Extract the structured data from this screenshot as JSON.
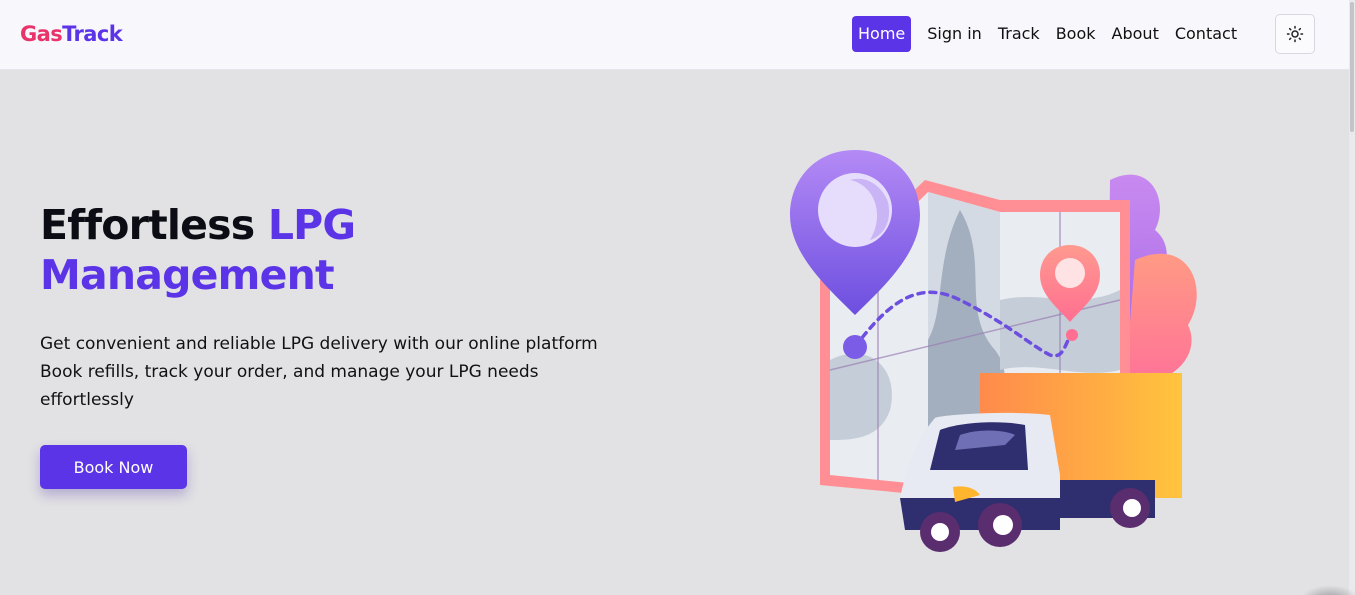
{
  "brand": {
    "part1": "Gas",
    "part2": "Track"
  },
  "nav": {
    "items": [
      {
        "label": "Home"
      },
      {
        "label": "Sign in"
      },
      {
        "label": "Track"
      },
      {
        "label": "Book"
      },
      {
        "label": "About"
      },
      {
        "label": "Contact"
      }
    ],
    "active": "Home",
    "theme_toggle_icon": "sun-icon"
  },
  "hero": {
    "title_part1": "Effortless",
    "title_accent_line1": "LPG",
    "title_accent_line2": "Management",
    "description_lines": [
      "Get convenient and reliable LPG delivery with our online platform",
      "Book refills, track your order, and manage your LPG needs",
      "effortlessly"
    ],
    "cta_label": "Book Now",
    "illustration_icon": "delivery-map-illustration"
  },
  "colors": {
    "brand_primary": "#5b34e8",
    "brand_secondary": "#e8336b",
    "background": "#e2e2e4",
    "navbar_background": "#f8f7fc"
  }
}
